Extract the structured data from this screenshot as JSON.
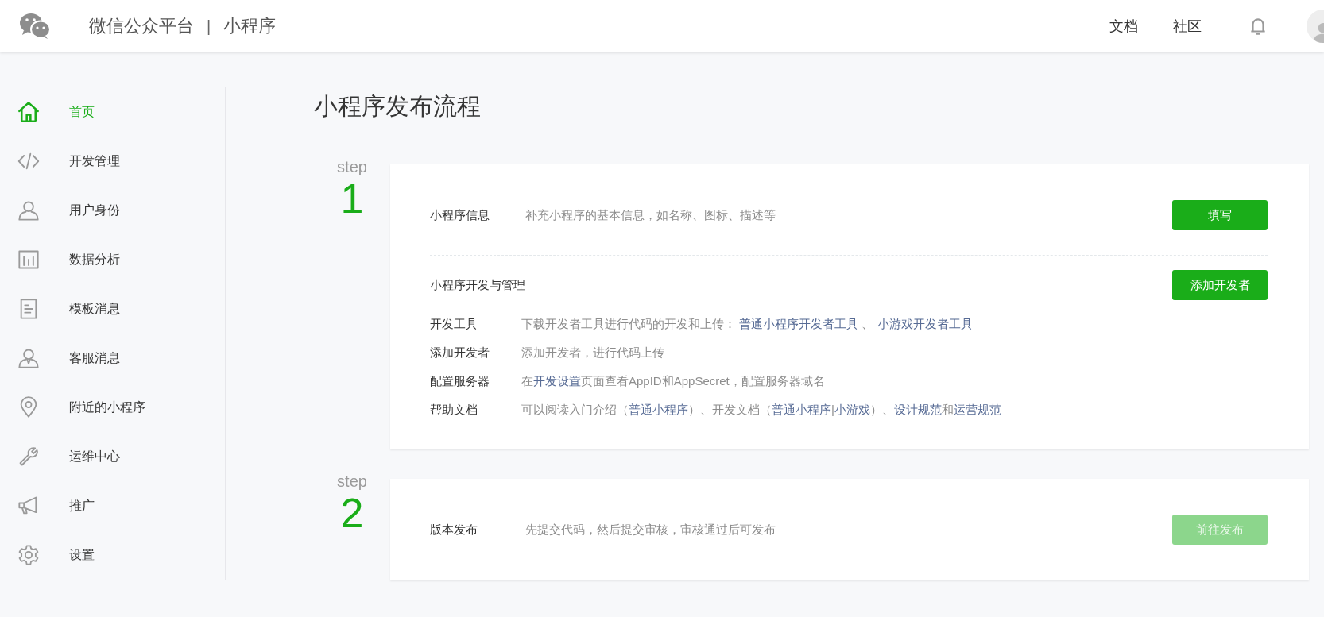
{
  "header": {
    "brand": "微信公众平台",
    "separator": "|",
    "product": "小程序",
    "nav": [
      {
        "label": "文档"
      },
      {
        "label": "社区"
      }
    ]
  },
  "sidebar": {
    "items": [
      {
        "label": "首页",
        "selected": true
      },
      {
        "label": "开发管理",
        "selected": false
      },
      {
        "label": "用户身份",
        "selected": false
      },
      {
        "label": "数据分析",
        "selected": false
      },
      {
        "label": "模板消息",
        "selected": false
      },
      {
        "label": "客服消息",
        "selected": false
      },
      {
        "label": "附近的小程序",
        "selected": false
      },
      {
        "label": "运维中心",
        "selected": false
      },
      {
        "label": "推广",
        "selected": false
      },
      {
        "label": "设置",
        "selected": false
      }
    ]
  },
  "page_title": "小程序发布流程",
  "steps": [
    {
      "step_label": "step",
      "number": "1",
      "blocks": [
        {
          "kind": "row",
          "label": "小程序信息",
          "description": [
            {
              "kind": "text",
              "text": "补充小程序的基本信息，如名称、图标、描述等"
            }
          ],
          "button": {
            "label": "填写",
            "disabled": false
          }
        },
        {
          "kind": "group",
          "title": "小程序开发与管理",
          "button": {
            "label": "添加开发者",
            "disabled": false
          },
          "rows": [
            {
              "label": "开发工具",
              "description": [
                {
                  "kind": "text",
                  "text": "下载开发者工具进行代码的开发和上传： "
                },
                {
                  "kind": "link",
                  "text": "普通小程序开发者工具"
                },
                {
                  "kind": "text",
                  "text": " 、 "
                },
                {
                  "kind": "link",
                  "text": "小游戏开发者工具"
                }
              ]
            },
            {
              "label": "添加开发者",
              "description": [
                {
                  "kind": "text",
                  "text": "添加开发者，进行代码上传"
                }
              ]
            },
            {
              "label": "配置服务器",
              "description": [
                {
                  "kind": "text",
                  "text": "在"
                },
                {
                  "kind": "link",
                  "text": "开发设置"
                },
                {
                  "kind": "text",
                  "text": "页面查看AppID和AppSecret，配置服务器域名"
                }
              ]
            },
            {
              "label": "帮助文档",
              "description": [
                {
                  "kind": "text",
                  "text": "可以阅读入门介绍（"
                },
                {
                  "kind": "link",
                  "text": "普通小程序"
                },
                {
                  "kind": "text",
                  "text": "）、开发文档（"
                },
                {
                  "kind": "link",
                  "text": "普通小程序"
                },
                {
                  "kind": "text",
                  "text": "|"
                },
                {
                  "kind": "link",
                  "text": "小游戏"
                },
                {
                  "kind": "text",
                  "text": "）、"
                },
                {
                  "kind": "link",
                  "text": "设计规范"
                },
                {
                  "kind": "text",
                  "text": "和"
                },
                {
                  "kind": "link",
                  "text": "运营规范"
                }
              ]
            }
          ]
        }
      ]
    },
    {
      "step_label": "step",
      "number": "2",
      "blocks": [
        {
          "kind": "row",
          "label": "版本发布",
          "description": [
            {
              "kind": "text",
              "text": "先提交代码，然后提交审核，审核通过后可发布"
            }
          ],
          "button": {
            "label": "前往发布",
            "disabled": true
          }
        }
      ]
    }
  ]
}
